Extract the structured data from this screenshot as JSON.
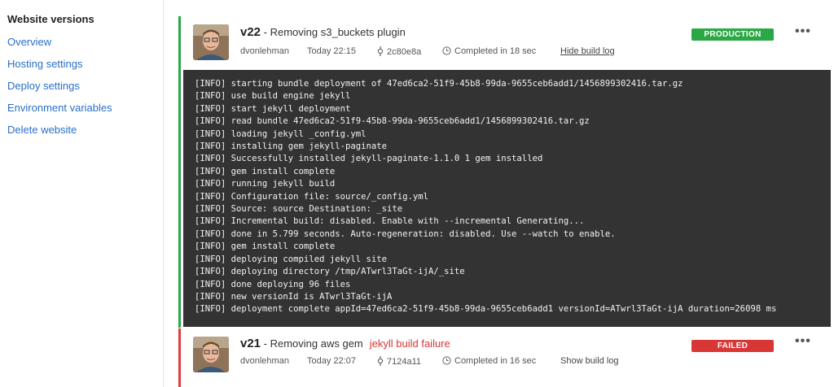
{
  "sidebar": {
    "title": "Website versions",
    "items": [
      {
        "label": "Overview"
      },
      {
        "label": "Hosting settings"
      },
      {
        "label": "Deploy settings"
      },
      {
        "label": "Environment variables"
      },
      {
        "label": "Delete website"
      }
    ]
  },
  "builds": [
    {
      "version": "v22",
      "separator": " - ",
      "message": "Removing s3_buckets plugin",
      "author": "dvonlehman",
      "time": "Today 22:15",
      "commit": "2c80e8a",
      "duration": "Completed in 18 sec",
      "log_toggle": "Hide build log",
      "status": "PRODUCTION",
      "status_color": "#2aa845",
      "more": "•••",
      "log": [
        "[INFO] starting bundle deployment of 47ed6ca2-51f9-45b8-99da-9655ceb6add1/1456899302416.tar.gz",
        "[INFO] use build engine jekyll",
        "[INFO] start jekyll deployment",
        "[INFO] read bundle 47ed6ca2-51f9-45b8-99da-9655ceb6add1/1456899302416.tar.gz",
        "[INFO] loading jekyll _config.yml",
        "[INFO] installing gem jekyll-paginate",
        "[INFO] Successfully installed jekyll-paginate-1.1.0 1 gem installed",
        "[INFO] gem install complete",
        "[INFO] running jekyll build",
        "[INFO] Configuration file: source/_config.yml",
        "[INFO] Source: source Destination: _site",
        "[INFO] Incremental build: disabled. Enable with --incremental Generating...",
        "[INFO] done in 5.799 seconds. Auto-regeneration: disabled. Use --watch to enable.",
        "[INFO] gem install complete",
        "[INFO] deploying compiled jekyll site",
        "[INFO] deploying directory /tmp/ATwrl3TaGt-ijA/_site",
        "[INFO] done deploying 96 files",
        "[INFO] new versionId is ATwrl3TaGt-ijA",
        "[INFO] deployment complete appId=47ed6ca2-51f9-45b8-99da-9655ceb6add1 versionId=ATwrl3TaGt-ijA duration=26098 ms"
      ]
    },
    {
      "version": "v21",
      "separator": " - ",
      "message": "Removing aws gem",
      "failure_note": "jekyll build failure",
      "author": "dvonlehman",
      "time": "Today 22:07",
      "commit": "7124a11",
      "duration": "Completed in 16 sec",
      "log_toggle": "Show build log",
      "status": "FAILED",
      "status_color": "#d93636",
      "more": "•••"
    }
  ],
  "colors": {
    "link": "#2a6fc9",
    "success": "#2aa845",
    "failure": "#d93636",
    "log_bg": "#333333"
  },
  "icons": [
    "commit-icon",
    "clock-icon",
    "more-icon",
    "avatar"
  ]
}
